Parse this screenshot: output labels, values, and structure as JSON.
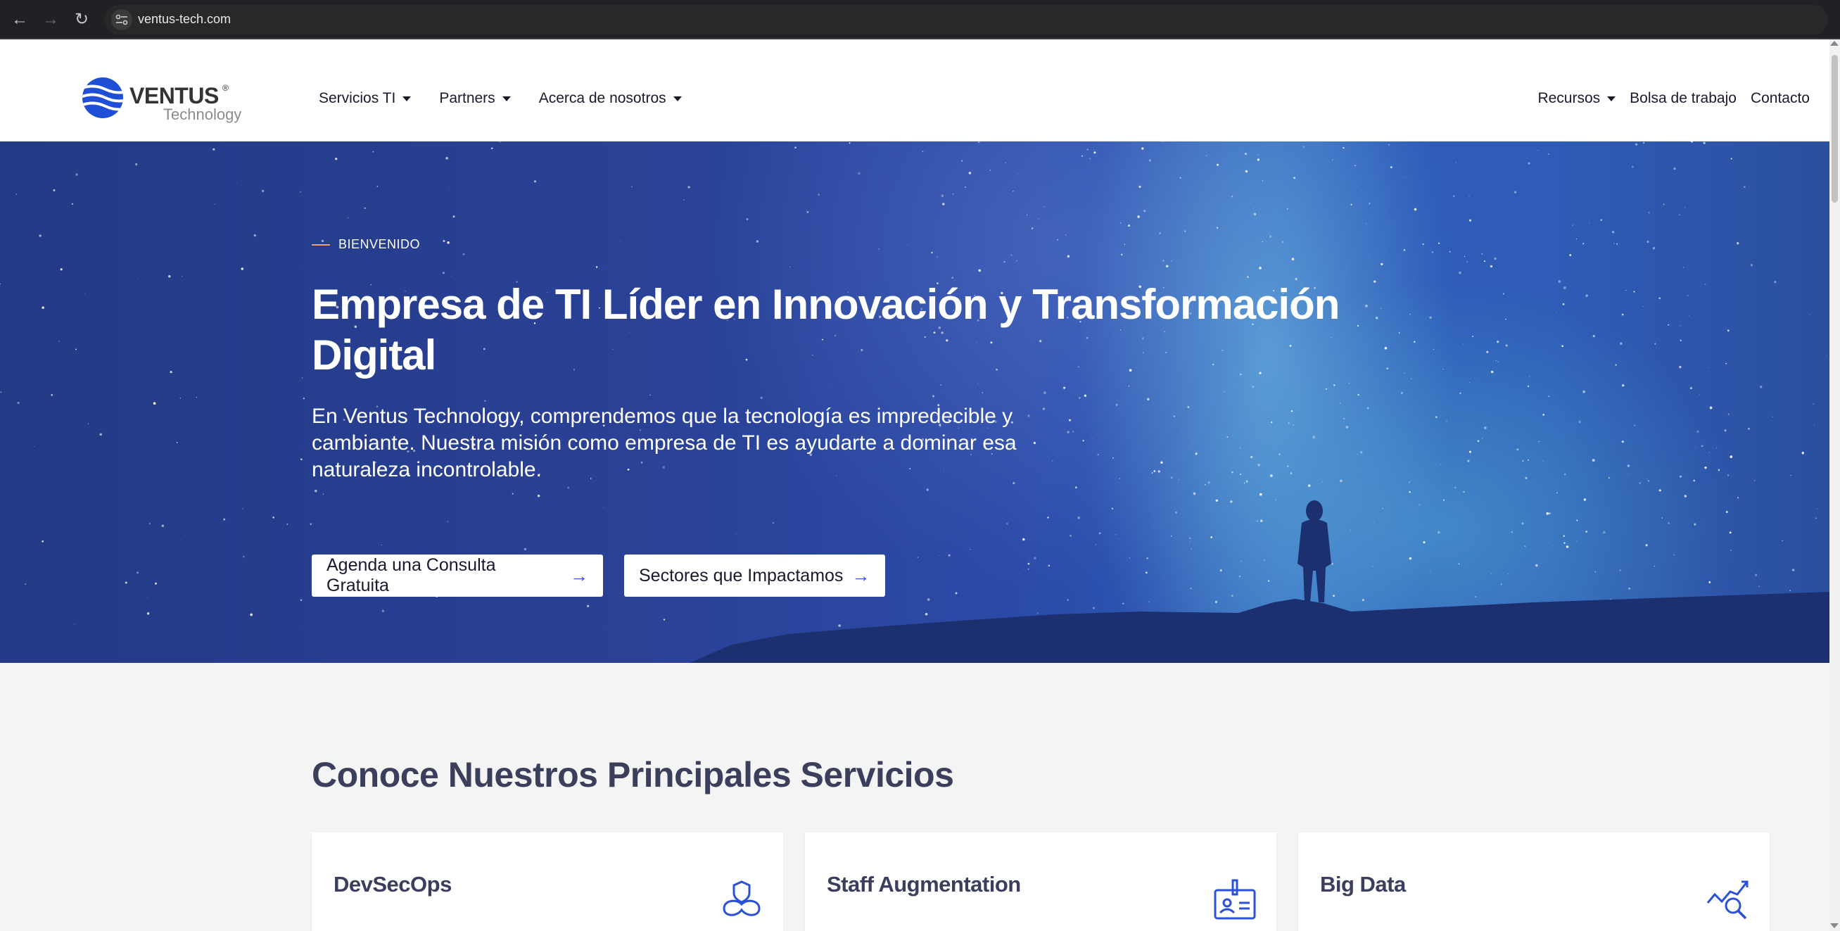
{
  "browser": {
    "url": "ventus-tech.com",
    "icons": [
      "back-arrow-icon",
      "forward-arrow-icon",
      "reload-icon",
      "site-info-icon"
    ]
  },
  "header": {
    "logo_name": "VENTUS",
    "logo_reg": "®",
    "logo_sub": "Technology",
    "nav_left": [
      {
        "label": "Servicios TI"
      },
      {
        "label": "Partners"
      },
      {
        "label": "Acerca de nosotros"
      }
    ],
    "nav_right": [
      {
        "label": "Recursos"
      },
      {
        "label": "Bolsa de trabajo"
      },
      {
        "label": "Contacto"
      }
    ]
  },
  "hero": {
    "eyebrow": "BIENVENIDO",
    "title": "Empresa de TI Líder en Innovación y Transformación Digital",
    "text": "En Ventus Technology, comprendemos que la tecnología es impredecible y cambiante. Nuestra misión como empresa de TI es ayudarte a dominar esa naturaleza incontrolable.",
    "cta_primary": "Agenda una Consulta Gratuita",
    "cta_secondary": "Sectores que Impactamos",
    "arrow": "→"
  },
  "services": {
    "title": "Conoce Nuestros Principales Servicios",
    "cards": [
      {
        "title": "DevSecOps",
        "icon": "shield-infinity-icon"
      },
      {
        "title": "Staff Augmentation",
        "icon": "id-badge-icon"
      },
      {
        "title": "Big Data",
        "icon": "chart-search-icon"
      }
    ]
  },
  "colors": {
    "accent": "#2a51d8",
    "hero_bg": "#2a4196",
    "text_dark": "#3b3f5c",
    "eyebrow_line": "#f0a070"
  }
}
